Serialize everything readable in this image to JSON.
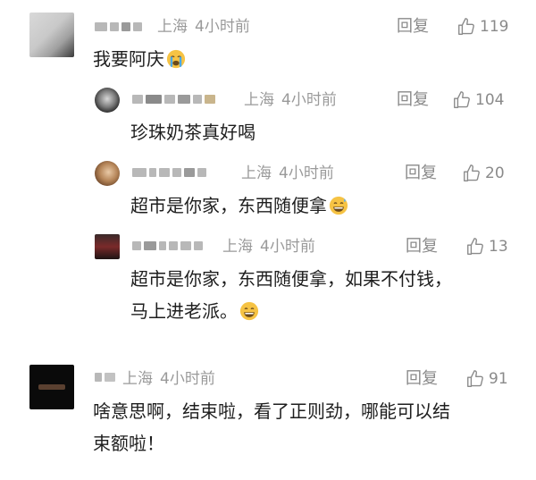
{
  "comments": [
    {
      "location": "上海",
      "time": "4小时前",
      "reply_label": "回复",
      "likes": "119",
      "text": "我要阿庆",
      "emoji": "crying-face-icon",
      "replies": [
        {
          "location": "上海",
          "time": "4小时前",
          "reply_label": "回复",
          "likes": "104",
          "text": "珍珠奶茶真好喝"
        },
        {
          "location": "上海",
          "time": "4小时前",
          "reply_label": "回复",
          "likes": "20",
          "text": "超市是你家，东西随便拿",
          "emoji": "grinning-sweat-icon"
        },
        {
          "location": "上海",
          "time": "4小时前",
          "reply_label": "回复",
          "likes": "13",
          "text_line1": "超市是你家，东西随便拿，如果不付钱，",
          "text_line2": "马上进老派。",
          "emoji": "grinning-face-icon"
        }
      ]
    },
    {
      "location": "上海",
      "time": "4小时前",
      "reply_label": "回复",
      "likes": "91",
      "text_line1": "啥意思啊，结束啦，看了正则劲，哪能可以结",
      "text_line2": "束额啦！"
    }
  ],
  "colors": {
    "meta": "#9a9a9a",
    "text": "#1e1e1e",
    "emoji_yellow": "#f6c344"
  }
}
